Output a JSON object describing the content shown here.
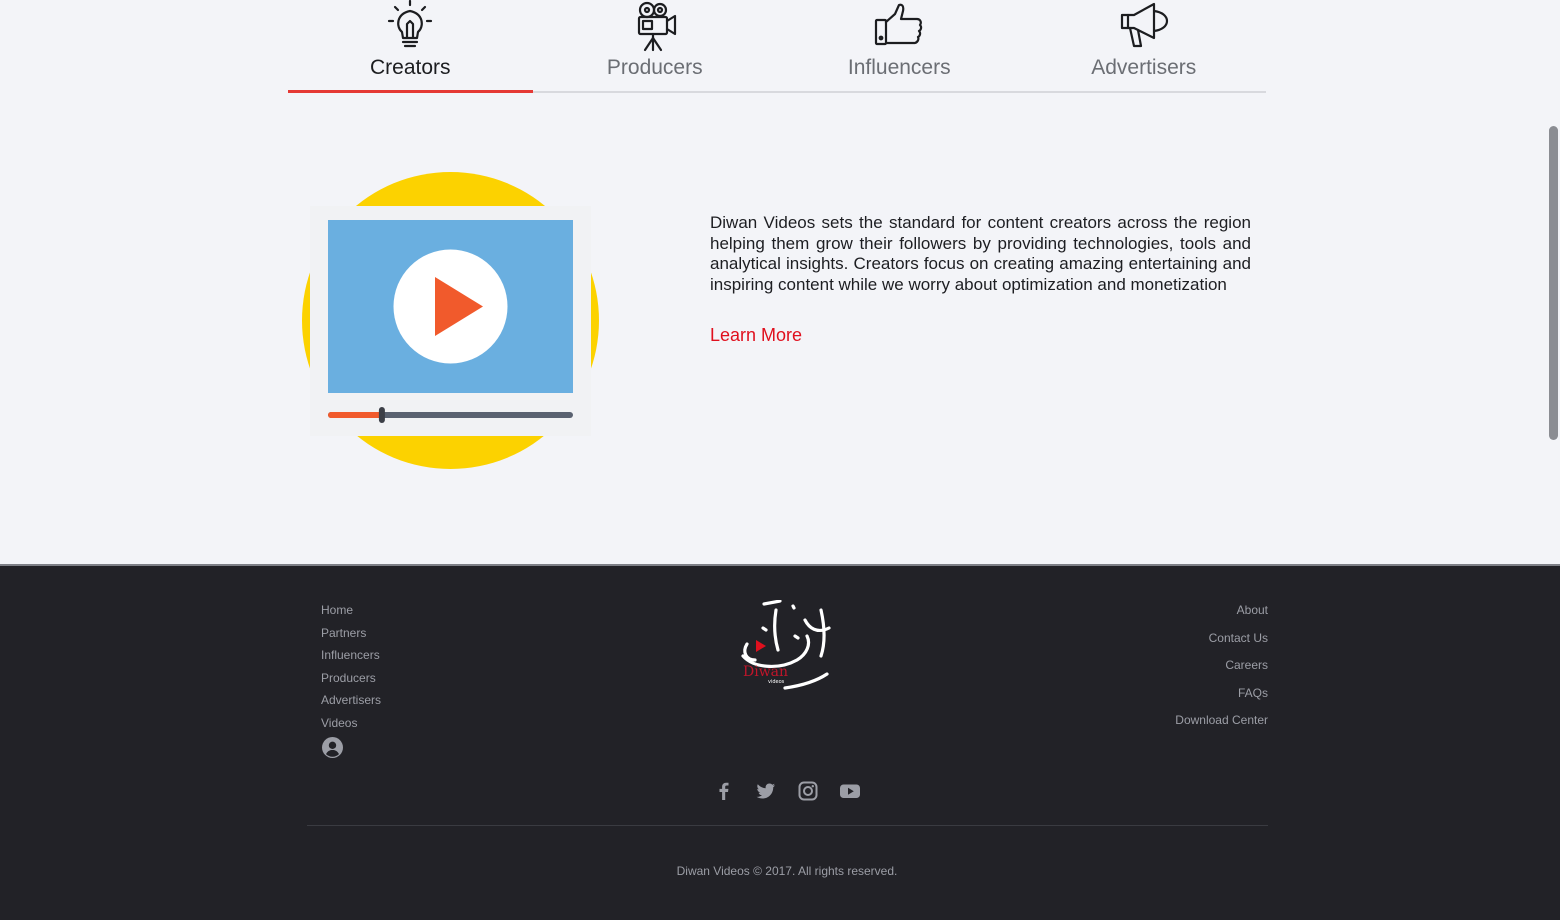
{
  "tabs": [
    {
      "label": "Creators",
      "icon": "lightbulb-icon",
      "active": true
    },
    {
      "label": "Producers",
      "icon": "movie-camera-icon",
      "active": false
    },
    {
      "label": "Influencers",
      "icon": "thumbs-up-icon",
      "active": false
    },
    {
      "label": "Advertisers",
      "icon": "megaphone-icon",
      "active": false
    }
  ],
  "hero": {
    "illustration": "video-player-icon",
    "video_progress": 0.22,
    "description": "Diwan Videos sets the standard for content creators across the region helping them grow their followers by providing technologies, tools and analytical insights. Creators focus on creating amazing entertaining and inspiring content while we worry about optimization and monetization",
    "learn_more": "Learn More"
  },
  "footer": {
    "left_links": [
      "Home",
      "Partners",
      "Influencers",
      "Producers",
      "Advertisers",
      "Videos"
    ],
    "account_icon": "user-circle-icon",
    "right_links": [
      "About",
      "Contact Us",
      "Careers",
      "FAQs",
      "Download Center"
    ],
    "logo_text": "Diwan",
    "logo_subtext": "videos",
    "social": [
      "facebook-icon",
      "twitter-icon",
      "instagram-icon",
      "youtube-icon"
    ],
    "copyright": "Diwan Videos © 2017. All rights reserved."
  },
  "colors": {
    "accent_red": "#e53935",
    "link_red": "#e0101e",
    "footer_bg": "#222227",
    "page_bg": "#f3f4f8",
    "circle_yellow": "#fcd200",
    "screen_blue": "#6aafe0",
    "play_orange": "#f15a2c"
  }
}
